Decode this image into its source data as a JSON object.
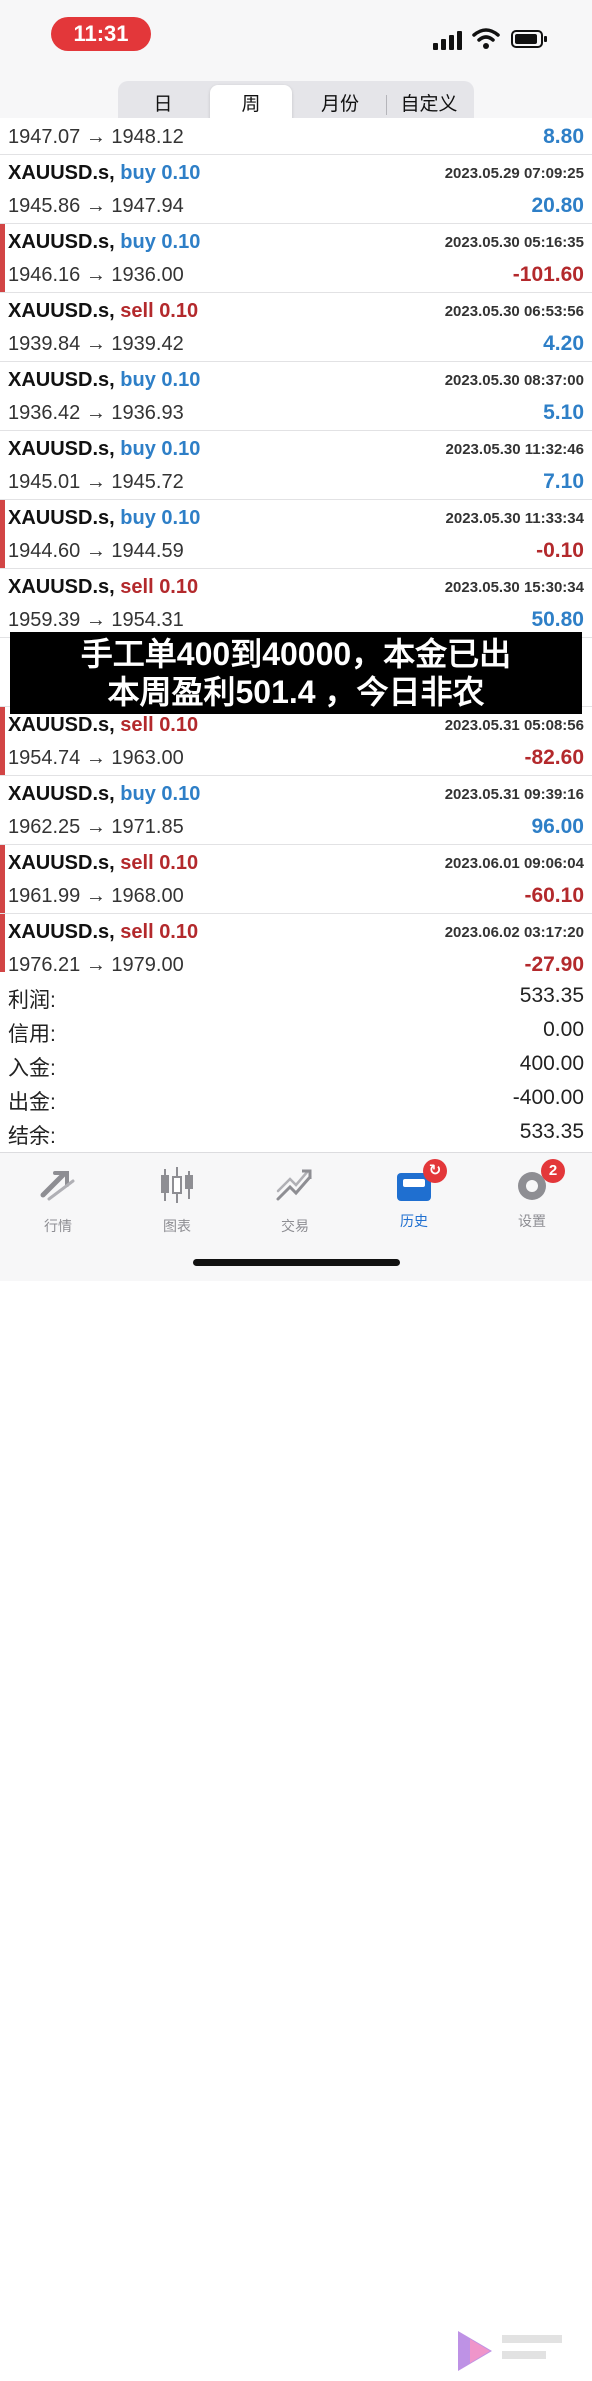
{
  "status_bar": {
    "time": "11:31"
  },
  "period_tabs": [
    "日",
    "周",
    "月份",
    "自定义"
  ],
  "active_period": "周",
  "trades": [
    {
      "symbol": "XAUUSD.s,",
      "direction": "buy",
      "volume": "0.10",
      "open": "1947.07",
      "close": "1948.12",
      "time": "",
      "profit": "8.80",
      "partial_top": true
    },
    {
      "symbol": "XAUUSD.s,",
      "direction": "buy",
      "volume": "0.10",
      "open": "1945.86",
      "close": "1947.94",
      "time": "2023.05.29 07:09:25",
      "profit": "20.80"
    },
    {
      "symbol": "XAUUSD.s,",
      "direction": "buy",
      "volume": "0.10",
      "open": "1946.16",
      "close": "1936.00",
      "time": "2023.05.30 05:16:35",
      "profit": "-101.60"
    },
    {
      "symbol": "XAUUSD.s,",
      "direction": "sell",
      "volume": "0.10",
      "open": "1939.84",
      "close": "1939.42",
      "time": "2023.05.30 06:53:56",
      "profit": "4.20"
    },
    {
      "symbol": "XAUUSD.s,",
      "direction": "buy",
      "volume": "0.10",
      "open": "1936.42",
      "close": "1936.93",
      "time": "2023.05.30 08:37:00",
      "profit": "5.10"
    },
    {
      "symbol": "XAUUSD.s,",
      "direction": "buy",
      "volume": "0.10",
      "open": "1945.01",
      "close": "1945.72",
      "time": "2023.05.30 11:32:46",
      "profit": "7.10"
    },
    {
      "symbol": "XAUUSD.s,",
      "direction": "buy",
      "volume": "0.10",
      "open": "1944.60",
      "close": "1944.59",
      "time": "2023.05.30 11:33:34",
      "profit": "-0.10"
    },
    {
      "symbol": "XAUUSD.s,",
      "direction": "sell",
      "volume": "0.10",
      "open": "1959.39",
      "close": "1954.31",
      "time": "2023.05.30 15:30:34",
      "profit": "50.80"
    },
    {
      "symbol": "",
      "direction": "",
      "volume": "",
      "open": "",
      "close": "",
      "time": "",
      "profit": "",
      "hidden": true
    },
    {
      "symbol": "XAUUSD.s,",
      "direction": "sell",
      "volume": "0.10",
      "open": "1954.74",
      "close": "1963.00",
      "time": "2023.05.31 05:08:56",
      "profit": "-82.60"
    },
    {
      "symbol": "XAUUSD.s,",
      "direction": "buy",
      "volume": "0.10",
      "open": "1962.25",
      "close": "1971.85",
      "time": "2023.05.31 09:39:16",
      "profit": "96.00"
    },
    {
      "symbol": "XAUUSD.s,",
      "direction": "sell",
      "volume": "0.10",
      "open": "1961.99",
      "close": "1968.00",
      "time": "2023.06.01 09:06:04",
      "profit": "-60.10"
    },
    {
      "symbol": "XAUUSD.s,",
      "direction": "sell",
      "volume": "0.10",
      "open": "1976.21",
      "close": "1979.00",
      "time": "2023.06.02 03:17:20",
      "profit": "-27.90"
    }
  ],
  "arrow": "→",
  "summary": [
    {
      "label": "利润:",
      "value": "533.35"
    },
    {
      "label": "信用:",
      "value": "0.00"
    },
    {
      "label": "入金:",
      "value": "400.00"
    },
    {
      "label": "出金:",
      "value": "-400.00"
    },
    {
      "label": "结余:",
      "value": "533.35"
    }
  ],
  "overlay": {
    "line1": "手工单400到40000，本金已出",
    "line2": "本周盈利501.4 ，今日非农"
  },
  "tabs": [
    {
      "label": "行情",
      "icon": "quotes-icon"
    },
    {
      "label": "图表",
      "icon": "chart-icon"
    },
    {
      "label": "交易",
      "icon": "trade-icon"
    },
    {
      "label": "历史",
      "icon": "history-icon",
      "active": true,
      "badge": ""
    },
    {
      "label": "设置",
      "icon": "settings-icon",
      "badge": "2"
    }
  ],
  "colors": {
    "buy": "#2e7fc7",
    "sell": "#b3292c",
    "accent": "#1f6fd0",
    "badge": "#e3373a"
  }
}
